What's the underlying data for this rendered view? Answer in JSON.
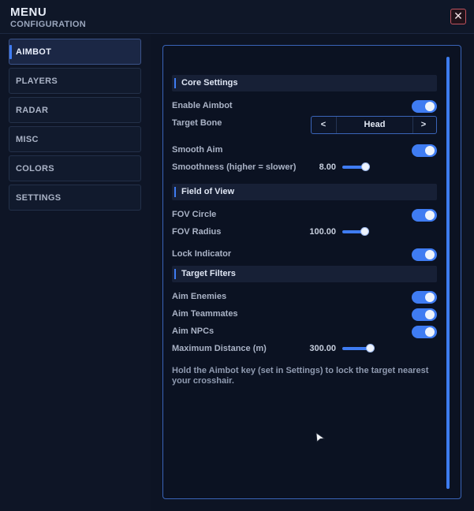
{
  "header": {
    "title": "MENU",
    "subtitle": "CONFIGURATION",
    "close_label": "✕"
  },
  "sidebar": {
    "items": [
      {
        "label": "AIMBOT",
        "active": true
      },
      {
        "label": "PLAYERS"
      },
      {
        "label": "RADAR"
      },
      {
        "label": "MISC"
      },
      {
        "label": "COLORS"
      },
      {
        "label": "SETTINGS"
      }
    ]
  },
  "sections": {
    "core": "Core Settings",
    "fov": "Field of View",
    "filters": "Target Filters"
  },
  "settings": {
    "enable_aimbot": {
      "label": "Enable Aimbot",
      "on": true
    },
    "target_bone": {
      "label": "Target Bone",
      "value": "Head",
      "prev": "<",
      "next": ">"
    },
    "smooth_aim": {
      "label": "Smooth Aim",
      "on": true
    },
    "smoothness": {
      "label": "Smoothness (higher = slower)",
      "value": "8.00"
    },
    "fov_circle": {
      "label": "FOV Circle",
      "on": true
    },
    "fov_radius": {
      "label": "FOV Radius",
      "value": "100.00"
    },
    "lock_indicator": {
      "label": "Lock Indicator",
      "on": true
    },
    "aim_enemies": {
      "label": "Aim Enemies",
      "on": true
    },
    "aim_teammates": {
      "label": "Aim Teammates",
      "on": true
    },
    "aim_npcs": {
      "label": "Aim NPCs",
      "on": true
    },
    "max_distance": {
      "label": "Maximum Distance (m)",
      "value": "300.00"
    }
  },
  "note": "Hold the Aimbot key (set in Settings) to lock the target nearest your crosshair.",
  "colors": {
    "accent": "#3f7cf2",
    "background": "#0d1424",
    "close_border": "#c2545f"
  }
}
